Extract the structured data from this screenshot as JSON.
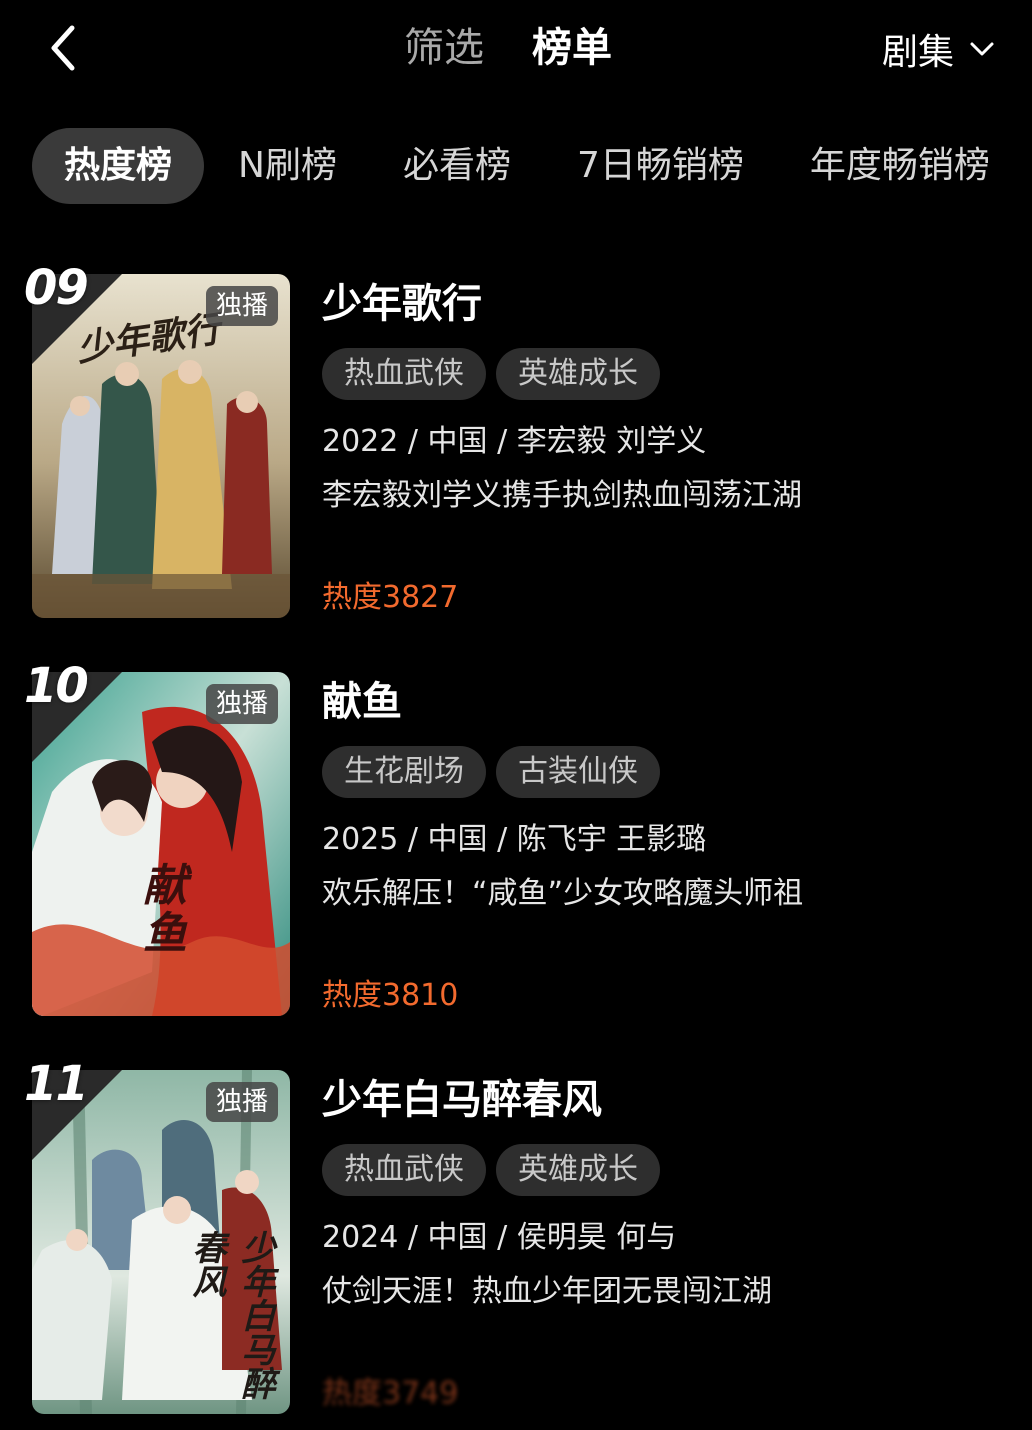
{
  "header": {
    "filter_label": "筛选",
    "rank_label": "榜单",
    "category_label": "剧集"
  },
  "subtabs": [
    {
      "label": "热度榜",
      "active": true
    },
    {
      "label": "N刷榜",
      "active": false
    },
    {
      "label": "必看榜",
      "active": false
    },
    {
      "label": "7日畅销榜",
      "active": false
    },
    {
      "label": "年度畅销榜",
      "active": false
    }
  ],
  "items": [
    {
      "rank": "09",
      "badge": "独播",
      "poster_text": "少年歌行",
      "title": "少年歌行",
      "tags": [
        "热血武侠",
        "英雄成长"
      ],
      "meta": "2022 / 中国 / 李宏毅 刘学义",
      "desc": "李宏毅刘学义携手执剑热血闯荡江湖",
      "heat": "热度3827"
    },
    {
      "rank": "10",
      "badge": "独播",
      "poster_text": "献鱼",
      "title": "献鱼",
      "tags": [
        "生花剧场",
        "古装仙侠"
      ],
      "meta": "2025 / 中国 / 陈飞宇 王影璐",
      "desc": "欢乐解压！“咸鱼”少女攻略魔头师祖",
      "heat": "热度3810"
    },
    {
      "rank": "11",
      "badge": "独播",
      "poster_text": "少年白马醉春风",
      "title": "少年白马醉春风",
      "tags": [
        "热血武侠",
        "英雄成长"
      ],
      "meta": "2024 / 中国 / 侯明昊 何与",
      "desc": "仗剑天涯！热血少年团无畏闯江湖",
      "heat": "热度3749"
    }
  ],
  "colors": {
    "background": "#000000",
    "accent_heat": "#f26a2e",
    "tag_bg": "#2e2e2e",
    "active_tab_bg": "#3a3a3a"
  }
}
